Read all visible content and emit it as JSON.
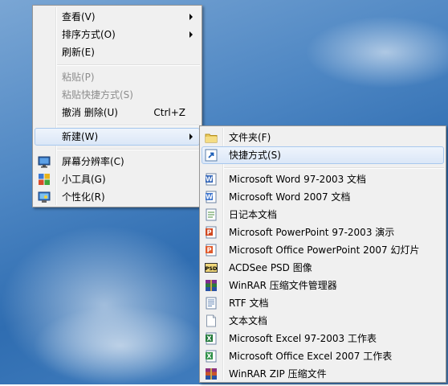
{
  "context_menu": {
    "items": [
      {
        "label": "查看(V)",
        "submenu": true
      },
      {
        "label": "排序方式(O)",
        "submenu": true
      },
      {
        "label": "刷新(E)"
      },
      {
        "label": "粘贴(P)",
        "disabled": true
      },
      {
        "label": "粘贴快捷方式(S)",
        "disabled": true
      },
      {
        "label": "撤消 删除(U)",
        "shortcut": "Ctrl+Z"
      },
      {
        "label": "新建(W)",
        "submenu": true,
        "highlighted": true
      },
      {
        "label": "屏幕分辨率(C)",
        "icon": "monitor-icon"
      },
      {
        "label": "小工具(G)",
        "icon": "gadgets-icon"
      },
      {
        "label": "个性化(R)",
        "icon": "personalize-icon"
      }
    ]
  },
  "new_submenu": {
    "items": [
      {
        "label": "文件夹(F)",
        "icon": "folder-icon"
      },
      {
        "label": "快捷方式(S)",
        "icon": "shortcut-icon",
        "highlighted": true
      },
      {
        "label": "Microsoft Word 97-2003 文档",
        "icon": "word-doc-icon"
      },
      {
        "label": "Microsoft Word 2007 文档",
        "icon": "word-docx-icon"
      },
      {
        "label": "日记本文档",
        "icon": "journal-icon"
      },
      {
        "label": "Microsoft PowerPoint 97-2003 演示",
        "icon": "powerpoint-icon"
      },
      {
        "label": "Microsoft Office PowerPoint 2007 幻灯片",
        "icon": "powerpoint-2007-icon"
      },
      {
        "label": "ACDSee PSD 图像",
        "icon": "psd-icon"
      },
      {
        "label": "WinRAR 压缩文件管理器",
        "icon": "winrar-icon"
      },
      {
        "label": "RTF 文档",
        "icon": "rtf-icon"
      },
      {
        "label": "文本文档",
        "icon": "text-doc-icon"
      },
      {
        "label": "Microsoft Excel 97-2003 工作表",
        "icon": "excel-icon"
      },
      {
        "label": "Microsoft Office Excel 2007 工作表",
        "icon": "excel-2007-icon"
      },
      {
        "label": "WinRAR ZIP 压缩文件",
        "icon": "winrar-zip-icon"
      }
    ]
  }
}
